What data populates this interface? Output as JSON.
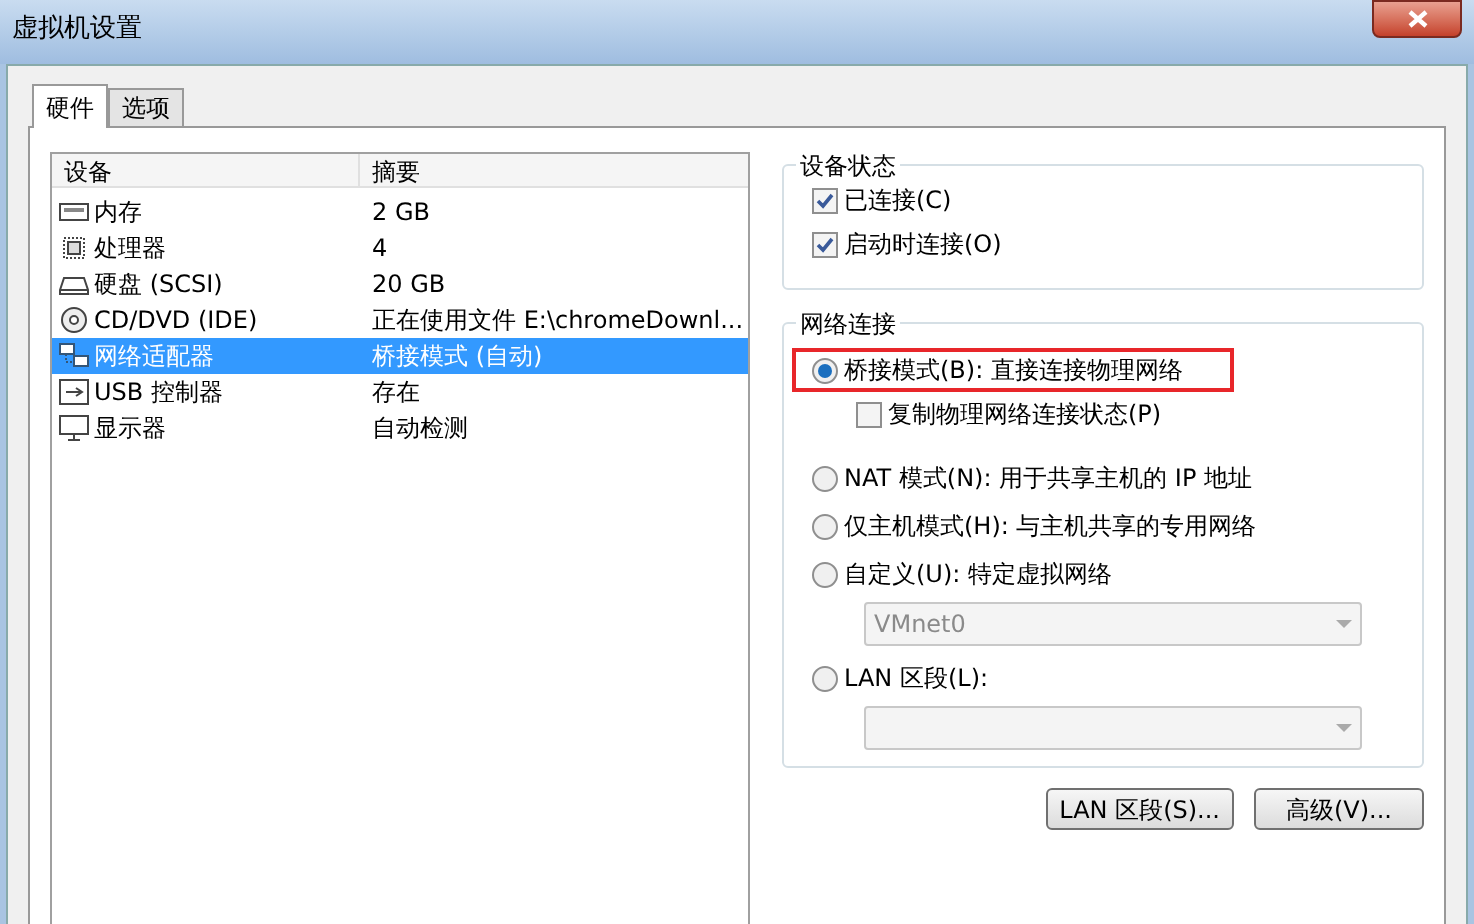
{
  "window": {
    "title": "虚拟机设置"
  },
  "tabs": [
    {
      "label": "硬件",
      "selected": true
    },
    {
      "label": "选项",
      "selected": false
    }
  ],
  "devices": {
    "columns": [
      "设备",
      "摘要"
    ],
    "rows": [
      {
        "kind": "memory",
        "name": "内存",
        "summary": "2 GB",
        "selected": false
      },
      {
        "kind": "cpu",
        "name": "处理器",
        "summary": "4",
        "selected": false
      },
      {
        "kind": "disk",
        "name": "硬盘 (SCSI)",
        "summary": "20 GB",
        "selected": false
      },
      {
        "kind": "cd",
        "name": "CD/DVD (IDE)",
        "summary": "正在使用文件 E:\\chromeDownl...",
        "selected": false
      },
      {
        "kind": "network",
        "name": "网络适配器",
        "summary": "桥接模式 (自动)",
        "selected": true
      },
      {
        "kind": "usb",
        "name": "USB 控制器",
        "summary": "存在",
        "selected": false
      },
      {
        "kind": "display",
        "name": "显示器",
        "summary": "自动检测",
        "selected": false
      }
    ]
  },
  "device_status": {
    "title": "设备状态",
    "options": [
      {
        "label": "已连接(C)",
        "checked": true
      },
      {
        "label": "启动时连接(O)",
        "checked": true
      }
    ]
  },
  "network_connection": {
    "title": "网络连接",
    "items": [
      {
        "kind": "radio",
        "label": "桥接模式(B): 直接连接物理网络",
        "selected": true,
        "highlighted": true
      },
      {
        "kind": "checkbox",
        "label": "复制物理网络连接状态(P)",
        "checked": false
      },
      {
        "kind": "radio",
        "label": "NAT 模式(N): 用于共享主机的 IP 地址",
        "selected": false,
        "highlighted": false
      },
      {
        "kind": "radio",
        "label": "仅主机模式(H): 与主机共享的专用网络",
        "selected": false,
        "highlighted": false
      },
      {
        "kind": "radio",
        "label": "自定义(U): 特定虚拟网络",
        "selected": false,
        "highlighted": false
      },
      {
        "kind": "dropdown",
        "value": "VMnet0",
        "disabled": true
      },
      {
        "kind": "radio",
        "label": "LAN 区段(L):",
        "selected": false,
        "highlighted": false
      },
      {
        "kind": "dropdown",
        "disabled": true
      }
    ]
  },
  "buttons": [
    "LAN 区段(S)...",
    "高级(V)..."
  ]
}
